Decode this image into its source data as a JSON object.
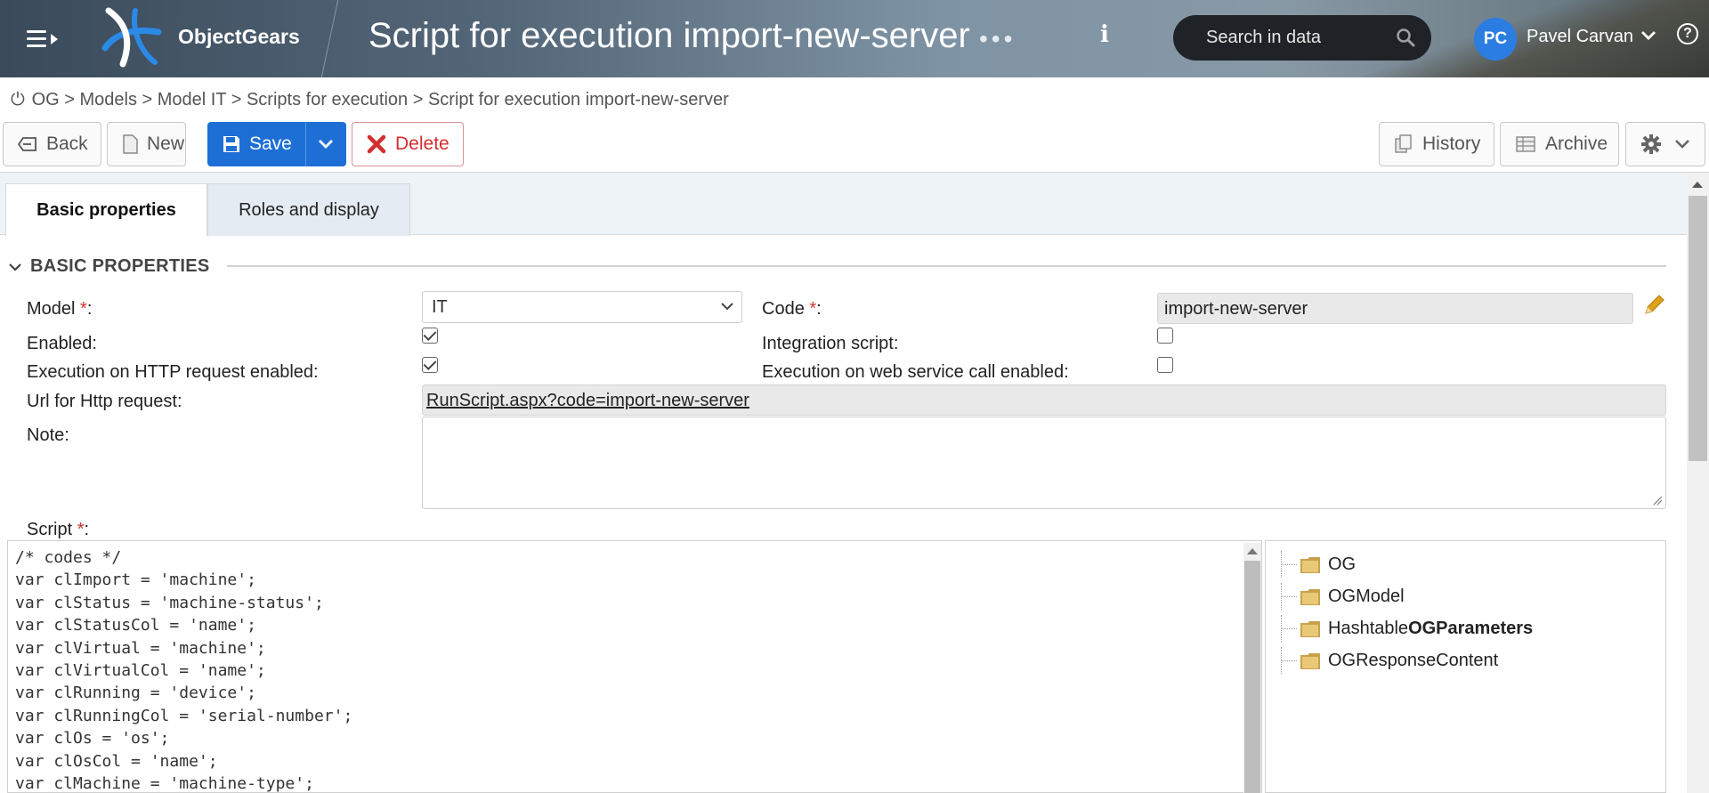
{
  "header": {
    "brand": "ObjectGears",
    "title": "Script for execution import-new-server",
    "more": "•••",
    "info": "i",
    "search_label": "Search in data",
    "avatar_initials": "PC",
    "user_name": "Pavel Carvan",
    "help": "?"
  },
  "breadcrumb": "OG > Models > Model IT > Scripts for execution > Script for execution import-new-server",
  "toolbar": {
    "back": "Back",
    "new": "New",
    "save": "Save",
    "delete": "Delete",
    "history": "History",
    "archive": "Archive"
  },
  "tabs": [
    {
      "label": "Basic properties",
      "active": true
    },
    {
      "label": "Roles and display",
      "active": false
    }
  ],
  "section": {
    "title": "BASIC PROPERTIES"
  },
  "form": {
    "model_label": "Model",
    "model_value": "IT",
    "code_label": "Code",
    "code_value": "import-new-server",
    "enabled_label": "Enabled:",
    "enabled": true,
    "integration_label": "Integration script:",
    "integration": false,
    "http_label": "Execution on HTTP request enabled:",
    "http": true,
    "ws_label": "Execution on web service call enabled:",
    "ws": false,
    "url_label": "Url for Http request:",
    "url_value": "RunScript.aspx?code=import-new-server",
    "note_label": "Note:",
    "script_label": "Script"
  },
  "script_lines": [
    "/* codes */",
    "var clImport = 'machine';",
    "var clStatus = 'machine-status';",
    "var clStatusCol = 'name';",
    "var clVirtual = 'machine';",
    "var clVirtualCol = 'name';",
    "var clRunning = 'device';",
    "var clRunningCol = 'serial-number';",
    "var clOs = 'os';",
    "var clOsCol = 'name';",
    "var clMachine = 'machine-type';"
  ],
  "tree": [
    {
      "prefix": "",
      "label": "OG"
    },
    {
      "prefix": "",
      "label": "OGModel"
    },
    {
      "prefix": "Hashtable ",
      "label": "OGParameters"
    },
    {
      "prefix": "",
      "label": "OGResponseContent"
    }
  ],
  "colors": {
    "primary": "#1d6fd6",
    "danger": "#d32f2f",
    "avatar": "#2b7de1"
  }
}
